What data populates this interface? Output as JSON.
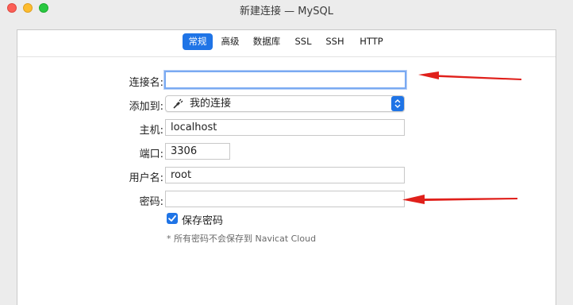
{
  "window": {
    "title": "新建连接 — MySQL"
  },
  "tabs": [
    {
      "label": "常规",
      "active": true
    },
    {
      "label": "高级",
      "active": false
    },
    {
      "label": "数据库",
      "active": false
    },
    {
      "label": "SSL",
      "active": false
    },
    {
      "label": "SSH",
      "active": false
    },
    {
      "label": "HTTP",
      "active": false
    }
  ],
  "form": {
    "connection_name": {
      "label": "连接名:",
      "value": ""
    },
    "add_to": {
      "label": "添加到:",
      "value": "我的连接"
    },
    "host": {
      "label": "主机:",
      "value": "localhost"
    },
    "port": {
      "label": "端口:",
      "value": "3306"
    },
    "username": {
      "label": "用户名:",
      "value": "root"
    },
    "password": {
      "label": "密码:",
      "value": ""
    },
    "save_password": {
      "label": "保存密码",
      "checked": true
    },
    "note": "* 所有密码不会保存到 Navicat Cloud"
  },
  "colors": {
    "accent": "#1f74e6",
    "annotation_arrow": "#e0201b"
  },
  "icons": {
    "add_to_icon": "connection-plug-icon"
  }
}
